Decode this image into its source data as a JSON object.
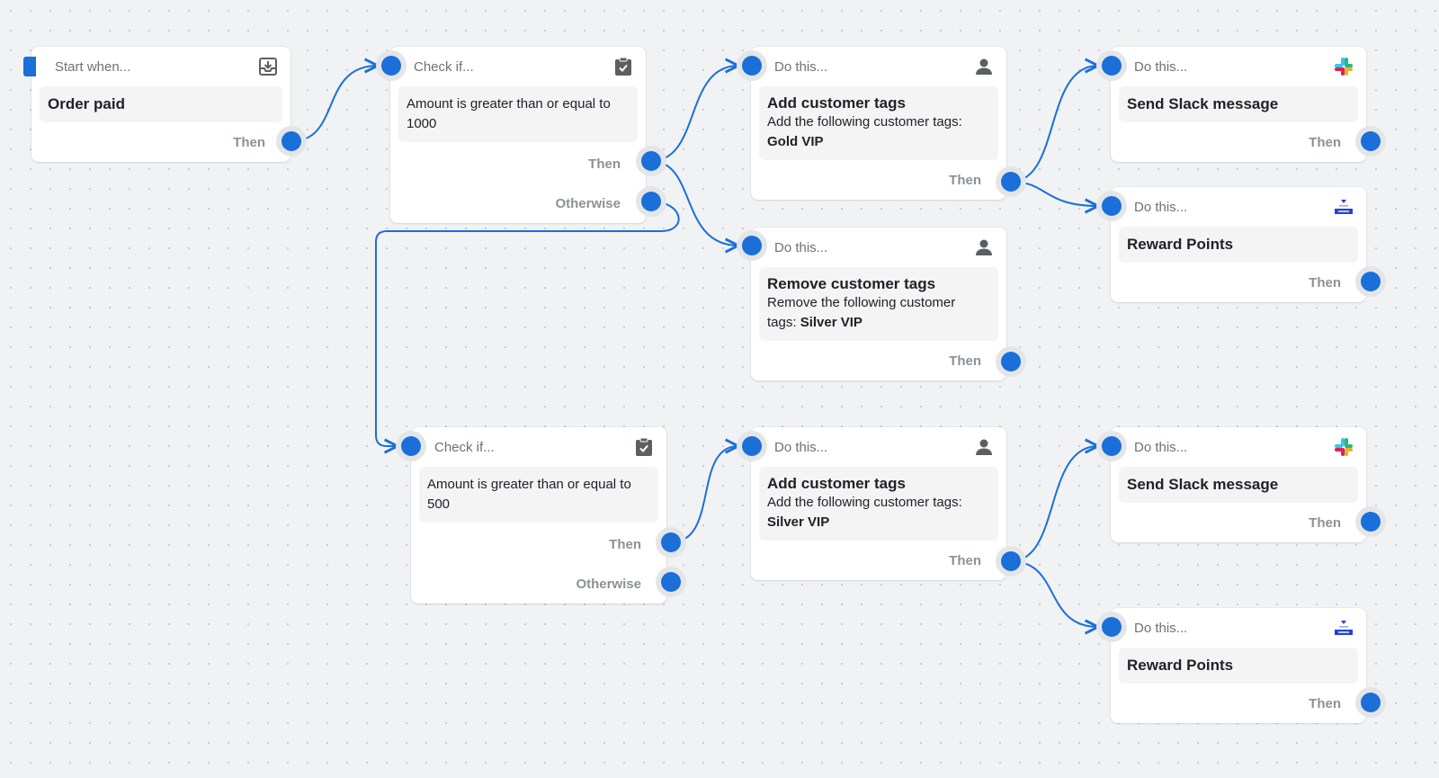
{
  "colors": {
    "accent": "#1a6fd9",
    "canvas": "#f1f2f4",
    "card": "#ffffff",
    "muted_text": "#8c9196",
    "icon_gray": "#5c5f62"
  },
  "nodes": {
    "trigger": {
      "kind": "Start when...",
      "icon": "download-tray-icon",
      "title": "Order paid",
      "outputs": [
        "Then"
      ]
    },
    "check1": {
      "kind": "Check if...",
      "icon": "clipboard-check-icon",
      "condition": "Amount is greater than or equal to 1000",
      "outputs": [
        "Then",
        "Otherwise"
      ]
    },
    "action_add_gold": {
      "kind": "Do this...",
      "icon": "customer-icon",
      "title": "Add customer tags",
      "desc_prefix": "Add the following customer tags:",
      "desc_value": "Gold VIP",
      "outputs": [
        "Then"
      ]
    },
    "action_remove_silver": {
      "kind": "Do this...",
      "icon": "customer-icon",
      "title": "Remove customer tags",
      "desc_prefix": "Remove the following customer tags:",
      "desc_value": "Silver VIP",
      "outputs": [
        "Then"
      ]
    },
    "slack1": {
      "kind": "Do this...",
      "icon": "slack-icon",
      "title": "Send Slack message",
      "outputs": [
        "Then"
      ]
    },
    "reward1": {
      "kind": "Do this...",
      "icon": "loyalty-app-icon",
      "title": "Reward Points",
      "outputs": [
        "Then"
      ]
    },
    "check2": {
      "kind": "Check if...",
      "icon": "clipboard-check-icon",
      "condition": "Amount is greater than or equal to 500",
      "outputs": [
        "Then",
        "Otherwise"
      ]
    },
    "action_add_silver": {
      "kind": "Do this...",
      "icon": "customer-icon",
      "title": "Add customer tags",
      "desc_prefix": "Add the following customer tags:",
      "desc_value": "Silver VIP",
      "outputs": [
        "Then"
      ]
    },
    "slack2": {
      "kind": "Do this...",
      "icon": "slack-icon",
      "title": "Send Slack message",
      "outputs": [
        "Then"
      ]
    },
    "reward2": {
      "kind": "Do this...",
      "icon": "loyalty-app-icon",
      "title": "Reward Points",
      "outputs": [
        "Then"
      ]
    }
  },
  "edges": [
    {
      "from": "trigger",
      "output": "Then",
      "to": "check1"
    },
    {
      "from": "check1",
      "output": "Then",
      "to": "action_add_gold"
    },
    {
      "from": "check1",
      "output": "Then",
      "to": "action_remove_silver"
    },
    {
      "from": "check1",
      "output": "Otherwise",
      "to": "check2"
    },
    {
      "from": "action_add_gold",
      "output": "Then",
      "to": "slack1"
    },
    {
      "from": "action_add_gold",
      "output": "Then",
      "to": "reward1"
    },
    {
      "from": "check2",
      "output": "Then",
      "to": "action_add_silver"
    },
    {
      "from": "action_add_silver",
      "output": "Then",
      "to": "slack2"
    },
    {
      "from": "action_add_silver",
      "output": "Then",
      "to": "reward2"
    }
  ]
}
